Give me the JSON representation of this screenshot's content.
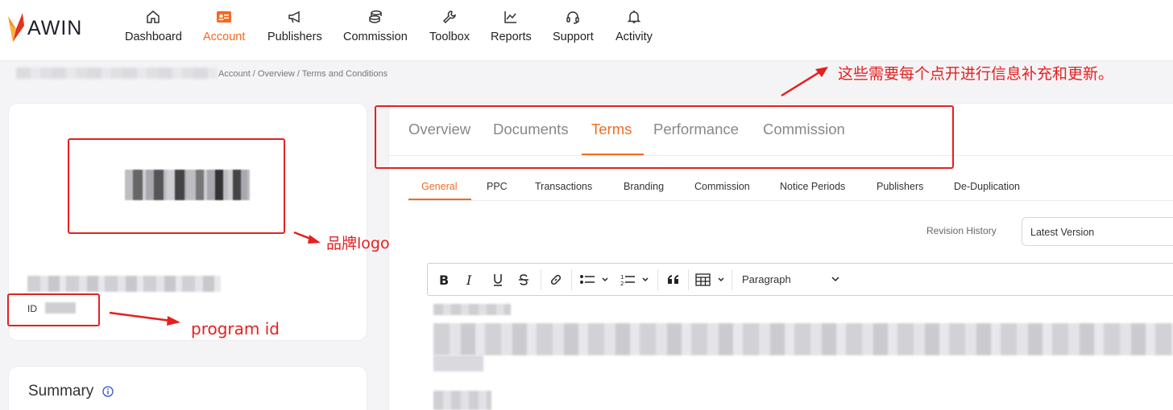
{
  "brand": {
    "logo_text": "AWIN",
    "accent": "#f26a21"
  },
  "nav": {
    "items": [
      {
        "label": "Dashboard",
        "icon": "home-icon",
        "active": false
      },
      {
        "label": "Account",
        "icon": "id-card-icon",
        "active": true
      },
      {
        "label": "Publishers",
        "icon": "megaphone-icon",
        "active": false
      },
      {
        "label": "Commission",
        "icon": "coins-icon",
        "active": false
      },
      {
        "label": "Toolbox",
        "icon": "wrench-icon",
        "active": false
      },
      {
        "label": "Reports",
        "icon": "chart-icon",
        "active": false
      },
      {
        "label": "Support",
        "icon": "headset-icon",
        "active": false
      },
      {
        "label": "Activity",
        "icon": "bell-icon",
        "active": false
      }
    ]
  },
  "breadcrumb": "Account / Overview / Terms and Conditions",
  "profile": {
    "id_label": "ID"
  },
  "summary": {
    "title": "Summary",
    "icon": "info-icon"
  },
  "tabs": [
    {
      "label": "Overview",
      "active": false
    },
    {
      "label": "Documents",
      "active": false
    },
    {
      "label": "Terms",
      "active": true
    },
    {
      "label": "Performance",
      "active": false
    },
    {
      "label": "Commission",
      "active": false
    }
  ],
  "subtabs": [
    {
      "label": "General",
      "active": true
    },
    {
      "label": "PPC",
      "active": false
    },
    {
      "label": "Transactions",
      "active": false
    },
    {
      "label": "Branding",
      "active": false
    },
    {
      "label": "Commission",
      "active": false
    },
    {
      "label": "Notice Periods",
      "active": false
    },
    {
      "label": "Publishers",
      "active": false
    },
    {
      "label": "De-Duplication",
      "active": false
    }
  ],
  "revision": {
    "label": "Revision History",
    "value": "Latest Version"
  },
  "editor": {
    "paragraph_label": "Paragraph"
  },
  "annotations": {
    "tabs_note": "这些需要每个点开进行信息补充和更新。",
    "logo_note": "品牌logo",
    "id_note": "program id",
    "color": "#e5201f"
  }
}
